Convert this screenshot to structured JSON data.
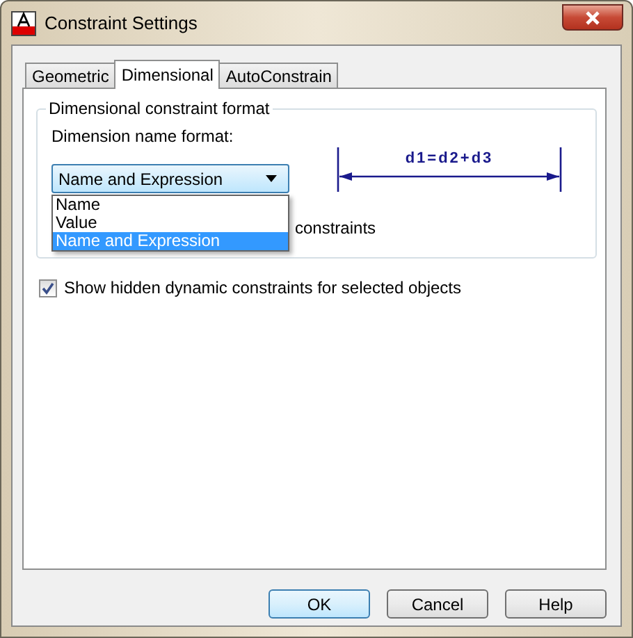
{
  "window": {
    "title": "Constraint Settings"
  },
  "tabs": [
    {
      "label": "Geometric",
      "selected": false
    },
    {
      "label": "Dimensional",
      "selected": true
    },
    {
      "label": "AutoConstrain",
      "selected": false
    }
  ],
  "group": {
    "title": "Dimensional constraint format",
    "field_label": "Dimension name format:",
    "dropdown": {
      "value": "Name and Expression",
      "expanded": true,
      "options": [
        {
          "label": "Name",
          "selected": false
        },
        {
          "label": "Value",
          "selected": false
        },
        {
          "label": "Name and Expression",
          "selected": true
        }
      ]
    },
    "preview_text": "d1=d2+d3",
    "hidden_option_label": "constraints"
  },
  "checkbox": {
    "label": "Show hidden dynamic constraints for selected objects",
    "checked": true
  },
  "buttons": [
    {
      "label": "OK",
      "default": true
    },
    {
      "label": "Cancel",
      "default": false
    },
    {
      "label": "Help",
      "default": false
    }
  ]
}
